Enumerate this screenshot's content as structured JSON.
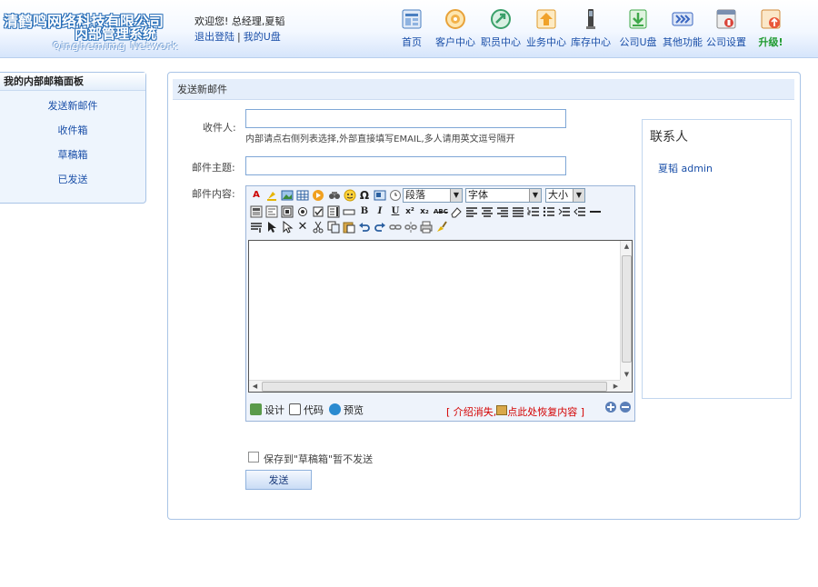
{
  "header": {
    "company": "清鹤鸣网络科技有限公司",
    "system": "内部管理系统",
    "english": "Qinghemimg Network",
    "welcome": "欢迎您! 总经理,夏韬",
    "logout": "退出登陆",
    "my_disk": "我的U盘",
    "nav": [
      {
        "label": "首页",
        "icon": "home-icon",
        "color": "#4a7fc1"
      },
      {
        "label": "客户中心",
        "icon": "customer-icon",
        "color": "#e8a23a"
      },
      {
        "label": "职员中心",
        "icon": "staff-icon",
        "color": "#3aa06a"
      },
      {
        "label": "业务中心",
        "icon": "business-icon",
        "color": "#e09a2a"
      },
      {
        "label": "库存中心",
        "icon": "inventory-icon",
        "color": "#555555"
      },
      {
        "label": "公司U盘",
        "icon": "company-disk-icon",
        "color": "#3fa84a"
      },
      {
        "label": "其他功能",
        "icon": "other-functions-icon",
        "color": "#3a66c0"
      },
      {
        "label": "公司设置",
        "icon": "company-settings-icon",
        "color": "#c84a3a"
      },
      {
        "label": "升级!",
        "icon": "upgrade-icon",
        "color": "#d04a2a"
      }
    ]
  },
  "left_panel": {
    "title": "我的内部邮箱面板",
    "items": [
      "发送新邮件",
      "收件箱",
      "草稿箱",
      "已发送"
    ]
  },
  "main": {
    "title": "发送新邮件",
    "recipient_label": "收件人:",
    "recipient_value": "",
    "recipient_hint": "内部请点右侧列表选择,外部直接填写EMAIL,多人请用英文逗号隔开",
    "subject_label": "邮件主题:",
    "subject_value": "",
    "content_label": "邮件内容:",
    "editor": {
      "paragraph_select": "段落",
      "font_select": "字体",
      "size_select": "大小",
      "mode_design": "设计",
      "mode_code": "代码",
      "mode_preview": "预览",
      "restore_prefix": "[ 介绍消失,",
      "restore_link": "点此处恢复内容",
      "restore_suffix": " ]"
    },
    "save_draft_label": "保存到\"草稿箱\"暂不发送",
    "send_label": "发送"
  },
  "contacts": {
    "title": "联系人",
    "items": [
      "夏韬 admin"
    ]
  }
}
